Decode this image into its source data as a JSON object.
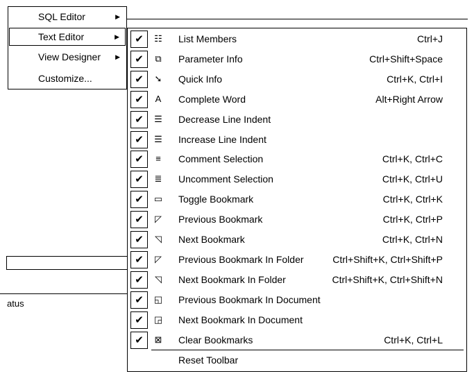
{
  "background": {
    "status_label": "atus"
  },
  "left_menu": {
    "items": [
      {
        "label": "SQL Editor",
        "has_submenu": true,
        "selected": false
      },
      {
        "label": "Text Editor",
        "has_submenu": true,
        "selected": true
      },
      {
        "label": "View Designer",
        "has_submenu": true,
        "selected": false
      },
      {
        "label": "Customize...",
        "has_submenu": false,
        "selected": false
      }
    ],
    "submenu_arrow": "▶"
  },
  "text_editor_menu": {
    "check_glyph": "✔",
    "items": [
      {
        "label": "List Members",
        "shortcut": "Ctrl+J",
        "icon": "list-members-icon",
        "checked": true
      },
      {
        "label": "Parameter Info",
        "shortcut": "Ctrl+Shift+Space",
        "icon": "parameter-info-icon",
        "checked": true
      },
      {
        "label": "Quick Info",
        "shortcut": "Ctrl+K, Ctrl+I",
        "icon": "quick-info-icon",
        "checked": true
      },
      {
        "label": "Complete Word",
        "shortcut": "Alt+Right Arrow",
        "icon": "complete-word-icon",
        "checked": true
      },
      {
        "label": "Decrease Line Indent",
        "shortcut": "",
        "icon": "decrease-indent-icon",
        "checked": true
      },
      {
        "label": "Increase Line Indent",
        "shortcut": "",
        "icon": "increase-indent-icon",
        "checked": true
      },
      {
        "label": "Comment Selection",
        "shortcut": "Ctrl+K, Ctrl+C",
        "icon": "comment-selection-icon",
        "checked": true
      },
      {
        "label": "Uncomment Selection",
        "shortcut": "Ctrl+K, Ctrl+U",
        "icon": "uncomment-selection-icon",
        "checked": true
      },
      {
        "label": "Toggle Bookmark",
        "shortcut": "Ctrl+K, Ctrl+K",
        "icon": "toggle-bookmark-icon",
        "checked": true
      },
      {
        "label": "Previous Bookmark",
        "shortcut": "Ctrl+K, Ctrl+P",
        "icon": "previous-bookmark-icon",
        "checked": true
      },
      {
        "label": "Next Bookmark",
        "shortcut": "Ctrl+K, Ctrl+N",
        "icon": "next-bookmark-icon",
        "checked": true
      },
      {
        "label": "Previous Bookmark In Folder",
        "shortcut": "Ctrl+Shift+K, Ctrl+Shift+P",
        "icon": "previous-bookmark-folder-icon",
        "checked": true
      },
      {
        "label": "Next Bookmark In Folder",
        "shortcut": "Ctrl+Shift+K, Ctrl+Shift+N",
        "icon": "next-bookmark-folder-icon",
        "checked": true
      },
      {
        "label": "Previous Bookmark In Document",
        "shortcut": "",
        "icon": "previous-bookmark-document-icon",
        "checked": true
      },
      {
        "label": "Next Bookmark In Document",
        "shortcut": "",
        "icon": "next-bookmark-document-icon",
        "checked": true
      },
      {
        "label": "Clear Bookmarks",
        "shortcut": "Ctrl+K, Ctrl+L",
        "icon": "clear-bookmarks-icon",
        "checked": true
      }
    ],
    "reset_label": "Reset Toolbar"
  }
}
